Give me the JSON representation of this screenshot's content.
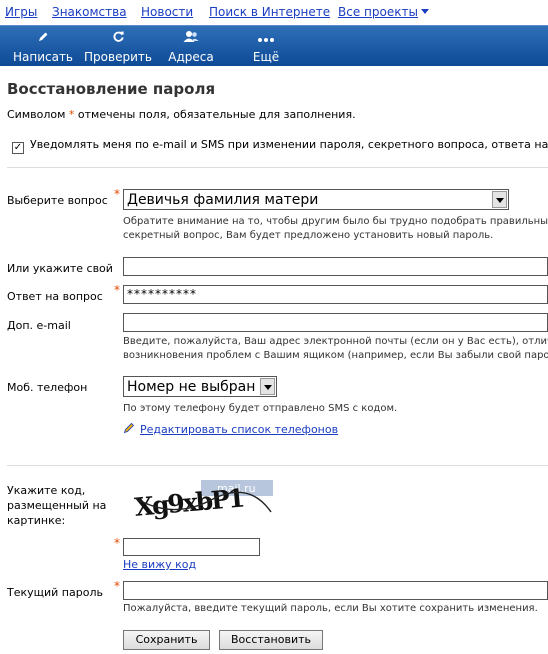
{
  "topnav": {
    "items": [
      "Игры",
      "Знакомства",
      "Новости",
      "Поиск в Интернете"
    ],
    "all_projects": "Все проекты"
  },
  "toolbar": {
    "write": "Написать",
    "check": "Проверить",
    "addresses": "Адреса",
    "more": "Ещё"
  },
  "page": {
    "title": "Восстановление пароля",
    "note_before": "Символом ",
    "note_star": "*",
    "note_after": " отмечены поля, обязательные для заполнения.",
    "notify_label": "Уведомлять меня по e-mail и SMS при изменении пароля, секретного вопроса, ответа на с",
    "notify_checked": "✓"
  },
  "form": {
    "question_label": "Выберите вопрос",
    "question_value": "Девичья фамилия матери",
    "question_hint_1": "Обратите внимание на то, чтобы другим было бы трудно подобрать правильный о",
    "question_hint_2": "секретный вопрос, Вам будет предложено установить новый пароль.",
    "own_question_label": "Или укажите свой",
    "own_question_value": "",
    "answer_label": "Ответ на вопрос",
    "answer_value": "**********",
    "email_label": "Доп. e-mail",
    "email_value": "",
    "email_hint_1": "Введите, пожалуйста, Ваш адрес электронной почты (если он у Вас есть), отличны",
    "email_hint_2": "возникновения проблем с Вашим ящиком (например, если Вы забыли свой пароль)",
    "phone_label": "Моб. телефон",
    "phone_value": "Номер не выбран",
    "phone_hint": "По этому телефону будет отправлено SMS с кодом.",
    "edit_phones_link": "Редактировать список телефонов",
    "captcha_label_1": "Укажите код,",
    "captcha_label_2": "размещенный на",
    "captcha_label_3": "картинке:",
    "captcha_text": "Xg9xbP1",
    "captcha_brand": "mail.ru",
    "captcha_value": "",
    "cant_see_link": "Не вижу код",
    "current_password_label": "Текущий пароль",
    "current_password_value": "",
    "current_password_hint": "Пожалуйста, введите текущий пароль, если Вы хотите сохранить изменения.",
    "required_mark": "*",
    "save_button": "Сохранить",
    "restore_button": "Восстановить"
  },
  "colors": {
    "link": "#1a3dc1",
    "toolbar": "#1d5ca8",
    "required": "#e04a00"
  }
}
